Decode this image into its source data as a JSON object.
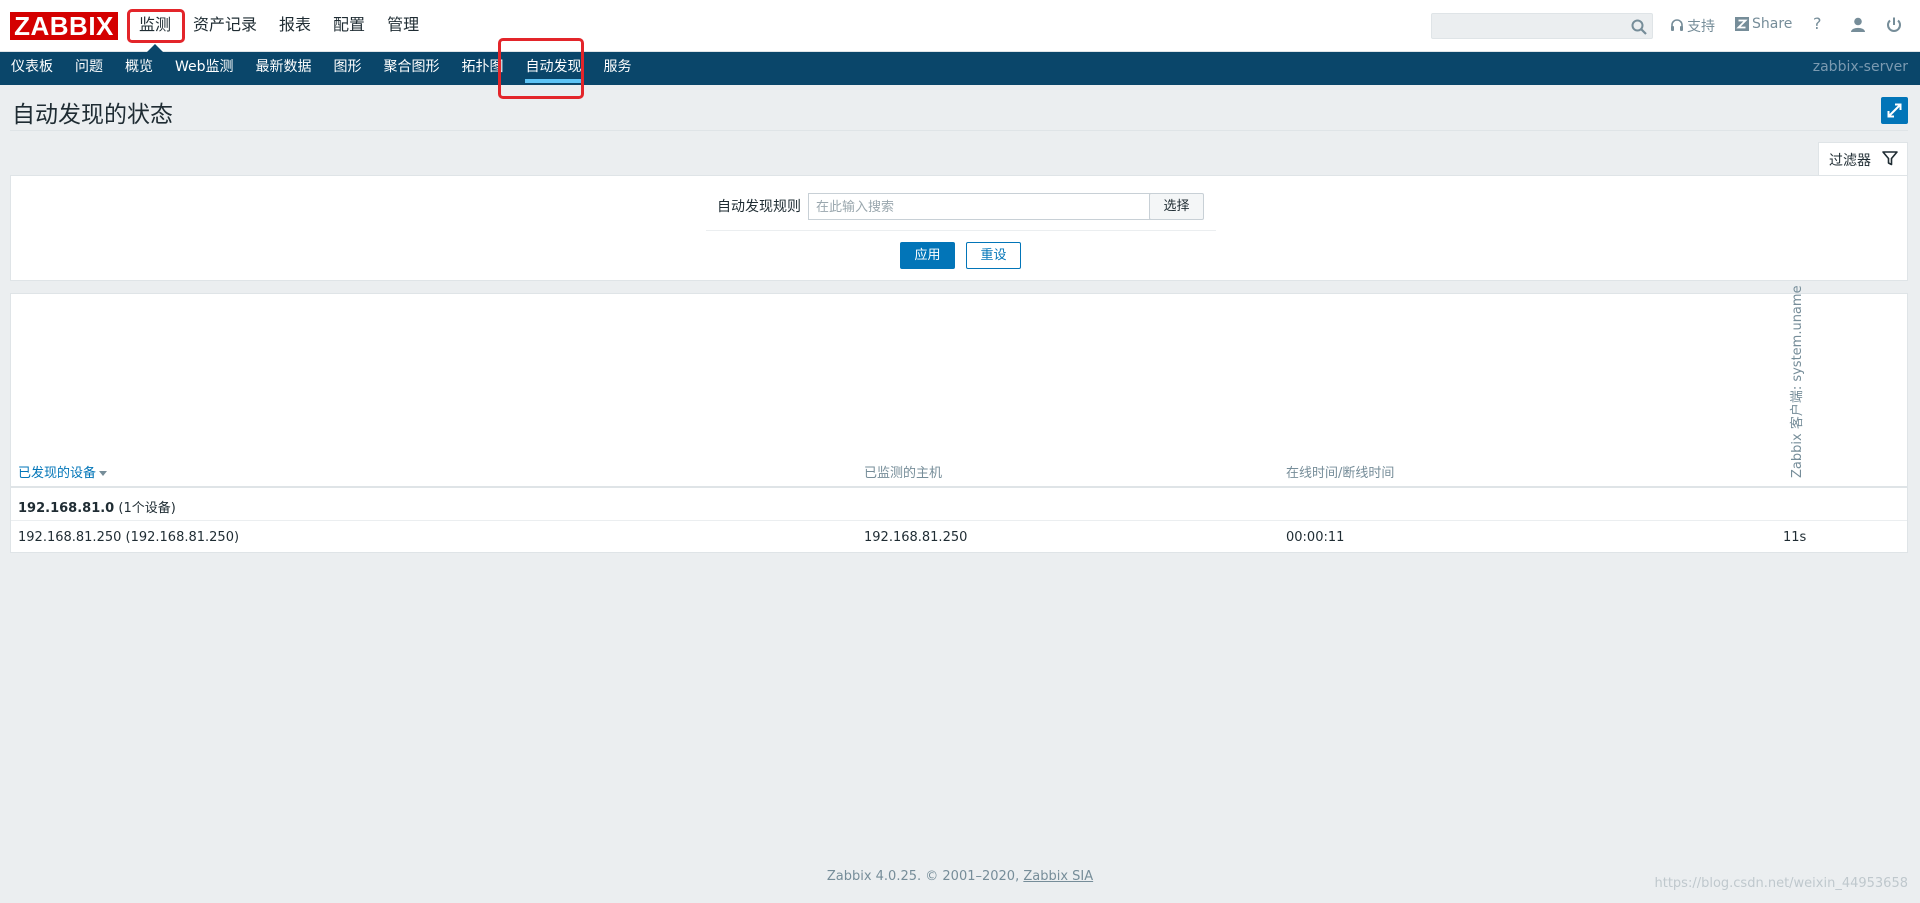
{
  "header": {
    "logo_text": "ZABBIX",
    "main_menu": [
      "监测",
      "资产记录",
      "报表",
      "配置",
      "管理"
    ],
    "search_placeholder": "",
    "support_label": "支持",
    "share_label": "Share",
    "help_label": "?"
  },
  "sub_nav": {
    "items": [
      "仪表板",
      "问题",
      "概览",
      "Web监测",
      "最新数据",
      "图形",
      "聚合图形",
      "拓扑图",
      "自动发现",
      "服务"
    ],
    "selected": "自动发现",
    "server_name": "zabbix-server"
  },
  "page": {
    "title": "自动发现的状态"
  },
  "filter": {
    "tab_label": "过滤器",
    "rule_label": "自动发现规则",
    "rule_placeholder": "在此输入搜索",
    "select_label": "选择",
    "apply_label": "应用",
    "reset_label": "重设"
  },
  "table": {
    "columns": {
      "discovered_device": "已发现的设备",
      "monitored_host": "已监测的主机",
      "uptime_downtime": "在线时间/断线时间",
      "check": "Zabbix 客户端: system.uname"
    },
    "group": {
      "name": "192.168.81.0",
      "count_text": "(1个设备)"
    },
    "rows": [
      {
        "device": "192.168.81.250 (192.168.81.250)",
        "host": "192.168.81.250",
        "uptime": "00:00:11",
        "check_value": "11s"
      }
    ]
  },
  "footer": {
    "text": "Zabbix 4.0.25. © 2001–2020,",
    "company": "Zabbix SIA"
  },
  "watermark": "https://blog.csdn.net/weixin_44953658",
  "colors": {
    "brand_red": "#d40000",
    "nav_blue": "#0a466a",
    "accent_blue": "#0275b8",
    "highlight_red": "#e3252a"
  }
}
